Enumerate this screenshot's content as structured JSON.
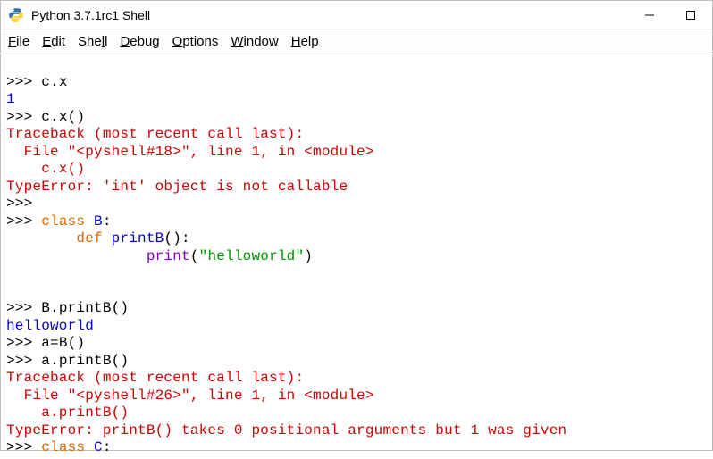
{
  "titlebar": {
    "title": "Python 3.7.1rc1 Shell"
  },
  "menu": {
    "file": "File",
    "edit": "Edit",
    "shell": "Shell",
    "debug": "Debug",
    "options": "Options",
    "window": "Window",
    "help": "Help"
  },
  "shell": {
    "l01_prompt": ">>> ",
    "l01_code": "c.x",
    "l02_output": "1",
    "l03_prompt": ">>> ",
    "l03_code": "c.x()",
    "l04_err": "Traceback (most recent call last):",
    "l05_err": "  File \"<pyshell#18>\", line 1, in <module>",
    "l06_err": "    c.x()",
    "l07_err": "TypeError: 'int' object is not callable",
    "l08_prompt": ">>>",
    "l09_prompt": ">>> ",
    "l09_kw": "class",
    "l09_name": " B",
    "l09_colon": ":",
    "l10_indent": "        ",
    "l10_kw": "def",
    "l10_name": " printB",
    "l10_rest": "():",
    "l11_indent": "                ",
    "l11_func": "print",
    "l11_open": "(",
    "l11_str": "\"helloworld\"",
    "l11_close": ")",
    "l12_blank": "",
    "l13_blank": "        ",
    "l14_prompt": ">>> ",
    "l14_code": "B.printB()",
    "l15_output": "helloworld",
    "l16_prompt": ">>> ",
    "l16_code": "a=B()",
    "l17_prompt": ">>> ",
    "l17_code": "a.printB()",
    "l18_err": "Traceback (most recent call last):",
    "l19_err": "  File \"<pyshell#26>\", line 1, in <module>",
    "l20_err": "    a.printB()",
    "l21_err": "TypeError: printB() takes 0 positional arguments but 1 was given",
    "l22_prompt": ">>> ",
    "l22_kw": "class",
    "l22_name": " C",
    "l22_colon": ":"
  }
}
